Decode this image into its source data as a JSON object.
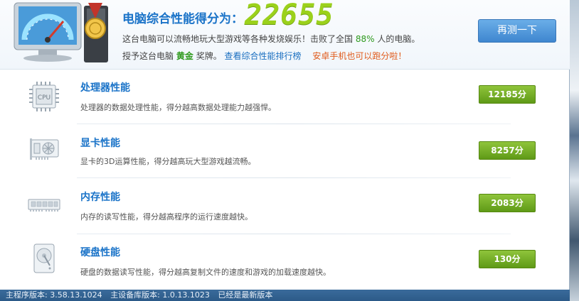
{
  "header": {
    "score_title": "电脑综合性能得分为：",
    "score_value": "22655",
    "desc1_prefix": "这台电脑可以流畅地玩大型游戏等各种发烧娱乐！击败了全国",
    "desc1_pct": "88%",
    "desc1_suffix": "人的电脑。",
    "desc2_prefix": "授予这台电脑",
    "desc2_medal": "黄金",
    "desc2_suffix": "奖牌。",
    "rank_link": "查看综合性能排行榜",
    "android_link": "安卓手机也可以跑分啦！",
    "retest_label": "再测一下"
  },
  "rows": [
    {
      "name": "处理器性能",
      "desc": "处理器的数据处理性能，得分越高数据处理能力越强悍。",
      "score": "12185分",
      "icon": "cpu-icon"
    },
    {
      "name": "显卡性能",
      "desc": "显卡的3D运算性能，得分越高玩大型游戏越流畅。",
      "score": "8257分",
      "icon": "graphics-card-icon"
    },
    {
      "name": "内存性能",
      "desc": "内存的读写性能，得分越高程序的运行速度越快。",
      "score": "2083分",
      "icon": "memory-icon"
    },
    {
      "name": "硬盘性能",
      "desc": "硬盘的数据读写性能，得分越高复制文件的速度和游戏的加载速度越快。",
      "score": "130分",
      "icon": "hard-disk-icon"
    }
  ],
  "status": {
    "main_version": "主程序版本: 3.58.13.1024",
    "db_version": "主设备库版本: 1.0.13.1023",
    "update_status": "已经是最新版本"
  },
  "colors": {
    "accent_blue": "#1a73c8",
    "score_green": "#9bd11b",
    "button_green": "#5f9a17",
    "statusbar": "#2c5a88"
  }
}
